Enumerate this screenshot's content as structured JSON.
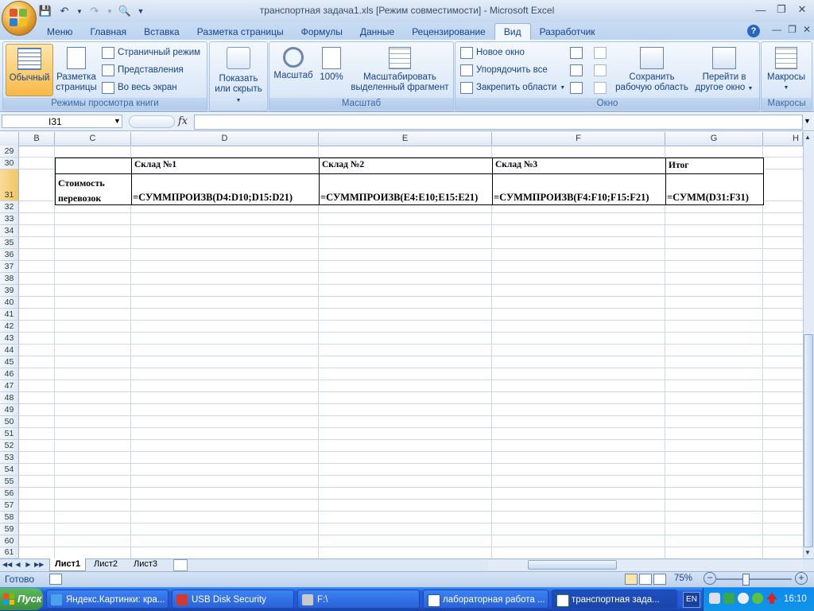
{
  "window": {
    "title": "транспортная задача1.xls  [Режим совместимости]  -  Microsoft Excel"
  },
  "tabs": [
    "Меню",
    "Главная",
    "Вставка",
    "Разметка страницы",
    "Формулы",
    "Данные",
    "Рецензирование",
    "Вид",
    "Разработчик"
  ],
  "ribbon": {
    "views": {
      "label": "Режимы просмотра книги",
      "normal": "Обычный",
      "page_layout_1": "Разметка",
      "page_layout_2": "страницы",
      "page_break": "Страничный режим",
      "custom_views": "Представления",
      "full_screen": "Во весь экран"
    },
    "show": {
      "line1": "Показать",
      "line2": "или скрыть"
    },
    "zoom": {
      "label": "Масштаб",
      "zoom": "Масштаб",
      "hundred": "100%",
      "sel_1": "Масштабировать",
      "sel_2": "выделенный фрагмент"
    },
    "window": {
      "label": "Окно",
      "new_window": "Новое окно",
      "arrange": "Упорядочить все",
      "freeze": "Закрепить области",
      "save_1": "Сохранить",
      "save_2": "рабочую область",
      "switch_1": "Перейти в",
      "switch_2": "другое окно"
    },
    "macros": {
      "label": "Макросы",
      "btn": "Макросы"
    }
  },
  "formula_bar": {
    "name_box": "I31",
    "fx": "fx",
    "formula": ""
  },
  "columns": [
    "B",
    "C",
    "D",
    "E",
    "F",
    "G",
    "H"
  ],
  "rows": [
    "29",
    "30",
    "31",
    "32",
    "33",
    "34",
    "35",
    "36",
    "37",
    "38",
    "39",
    "40",
    "41",
    "42",
    "43",
    "44",
    "45",
    "46",
    "47",
    "48",
    "49",
    "50",
    "51",
    "52",
    "53",
    "54",
    "55",
    "56",
    "57",
    "58",
    "59",
    "60",
    "61"
  ],
  "table": {
    "header": [
      "",
      "Склад №1",
      "Склад №2",
      "Склад №3",
      "Итог"
    ],
    "row_label_1": "Стоимость",
    "row_label_2": "перевозок",
    "formulas": [
      "=СУММПРОИЗВ(D4:D10;D15:D21)",
      "=СУММПРОИЗВ(E4:E10;E15:E21)",
      "=СУММПРОИЗВ(F4:F10;F15:F21)",
      "=СУММ(D31:F31)"
    ]
  },
  "sheets": [
    "Лист1",
    "Лист2",
    "Лист3"
  ],
  "status": {
    "text": "Готово",
    "zoom": "75%"
  },
  "taskbar": {
    "start": "Пуск",
    "items": [
      "Яндекс.Картинки: кра...",
      "USB Disk Security",
      "F:\\",
      "лабораторная работа ...",
      "транспортная зада..."
    ],
    "lang": "EN",
    "clock": "16:10"
  }
}
